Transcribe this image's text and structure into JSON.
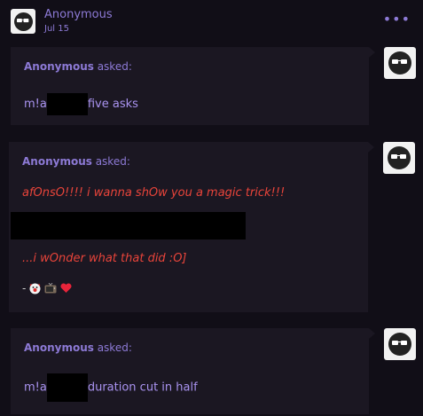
{
  "post": {
    "author": "Anonymous",
    "date": "Jul 15",
    "more_icon": "ellipsis-icon"
  },
  "asks": [
    {
      "asker": "Anonymous",
      "asked_label": "asked:",
      "text_before": "m!a",
      "text_after": "five asks"
    },
    {
      "asker": "Anonymous",
      "asked_label": "asked:",
      "line1": "afOnsO!!!! i wanna shOw you a magic trick!!!",
      "line3": "...i wOnder what that did :O]",
      "sign_prefix": "-",
      "sign_icons": [
        "clown-face-icon",
        "tv-icon",
        "heart-icon"
      ]
    },
    {
      "asker": "Anonymous",
      "asked_label": "asked:",
      "text_before": "m!a",
      "text_after": "duration cut in half"
    }
  ],
  "colors": {
    "background": "#110e17",
    "card": "#1b1722",
    "accent": "#8d7ad6",
    "red_text": "#e8443a"
  }
}
